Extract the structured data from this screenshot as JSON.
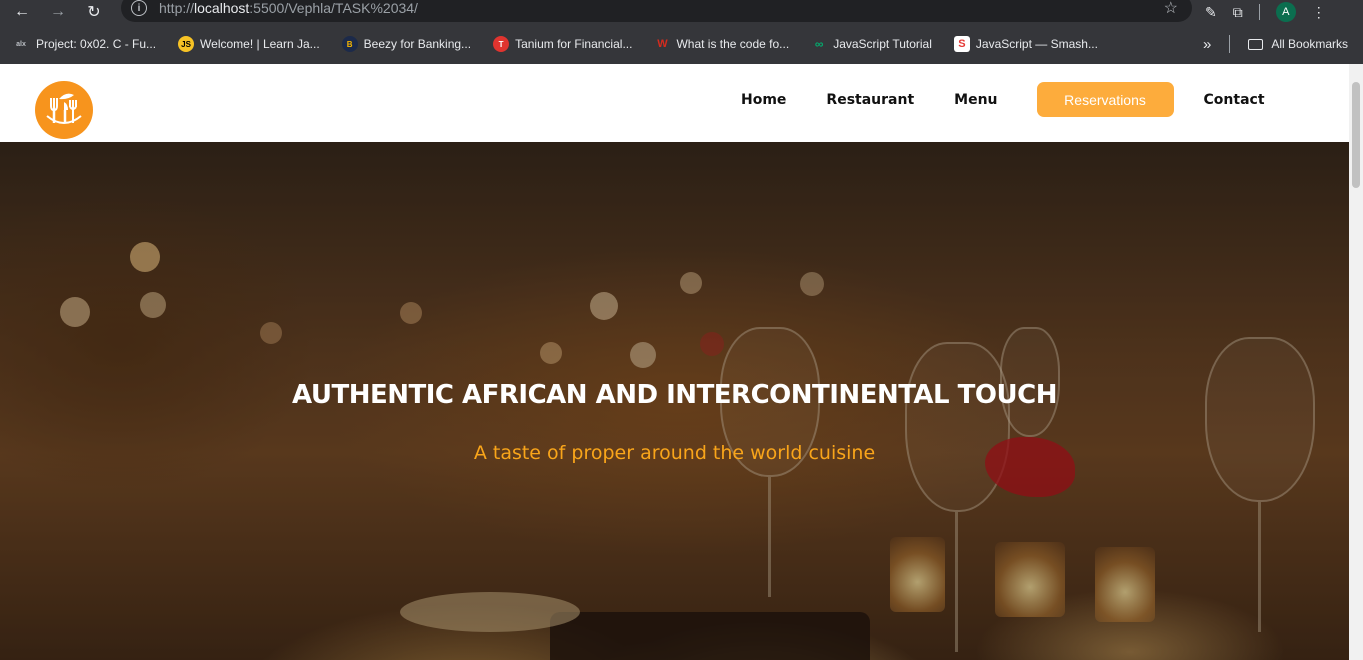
{
  "browser": {
    "url_scheme": "http://",
    "url_host": "localhost",
    "url_path": ":5500/Vephla/TASK%2034/",
    "avatar_letter": "A",
    "bookmarks": [
      {
        "label": "Project: 0x02. C - Fu...",
        "icon": "alx-icon",
        "icon_text": "alx",
        "color": "#35363a"
      },
      {
        "label": "Welcome! | Learn Ja...",
        "icon": "js-icon",
        "icon_text": "JS",
        "color": "#f7c325"
      },
      {
        "label": "Beezy for Banking...",
        "icon": "beezy-icon",
        "icon_text": "B",
        "color": "#f4b400"
      },
      {
        "label": "Tanium for Financial...",
        "icon": "tanium-icon",
        "icon_text": "T",
        "color": "#e0342f"
      },
      {
        "label": "What is the code fo...",
        "icon": "code-icon",
        "icon_text": "W",
        "color": "#d52b1e"
      },
      {
        "label": "JavaScript Tutorial",
        "icon": "w3-icon",
        "icon_text": "∞",
        "color": "#35363a"
      },
      {
        "label": "JavaScript — Smash...",
        "icon": "smashing-icon",
        "icon_text": "S",
        "color": "#e53935"
      }
    ],
    "more_label": "»",
    "all_bookmarks": "All Bookmarks"
  },
  "nav": {
    "home": "Home",
    "restaurant": "Restaurant",
    "menu": "Menu",
    "reservations": "Reservations",
    "contact": "Contact"
  },
  "hero": {
    "title": "AUTHENTIC AFRICAN AND INTERCONTINENTAL TOUCH",
    "subtitle": "A taste of proper around the world cuisine"
  },
  "colors": {
    "accent": "#fdac3c",
    "logo": "#f7941d",
    "subtitle": "#f9a51a"
  }
}
